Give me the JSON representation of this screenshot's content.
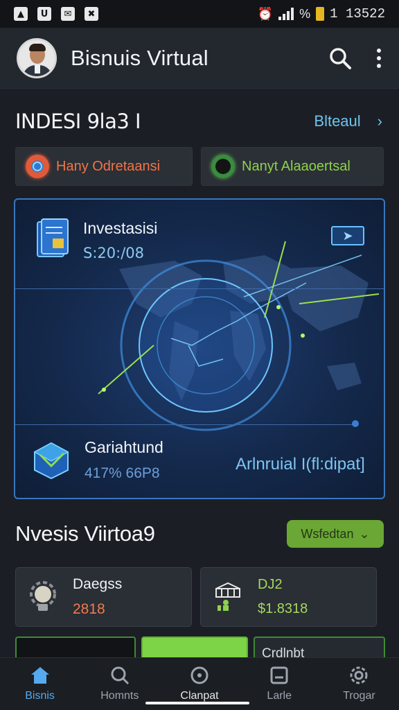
{
  "status_bar": {
    "time": "1 13522",
    "battery_pct": "%"
  },
  "header": {
    "title": "Bisnuis Virtual"
  },
  "section1": {
    "title": "INDESI 9la3 I",
    "link": "Blteaul",
    "pills": [
      {
        "label": "Hany Odretaansi",
        "color": "#f07548"
      },
      {
        "label": "Nanyt Alaaoertsal",
        "color": "#8ed14e"
      }
    ]
  },
  "hero": {
    "investasi_title": "Investasisi",
    "investasi_value": "S:20:/08",
    "gar_title": "Gariahtund",
    "gar_value": "417% 66P8",
    "link": "Arlnruial I(fl:dipat]"
  },
  "section2": {
    "title": "Nvesis Viirtoa9",
    "dropdown": "Wsfedtan",
    "cards": [
      {
        "title": "Daegss",
        "value": "2818"
      },
      {
        "title": "DJ2",
        "value": "$1.8318"
      }
    ],
    "peek_label": "Crdlnbt"
  },
  "bottom_nav": [
    {
      "label": "Bisnis",
      "icon": "home-icon"
    },
    {
      "label": "Homnts",
      "icon": "search-icon"
    },
    {
      "label": "Clanpat",
      "icon": "compass-icon"
    },
    {
      "label": "Larle",
      "icon": "wallet-icon"
    },
    {
      "label": "Trogar",
      "icon": "settings-icon"
    }
  ],
  "colors": {
    "accent_blue": "#56a9ef",
    "accent_green": "#6aa734",
    "accent_orange": "#ef7b4c"
  }
}
